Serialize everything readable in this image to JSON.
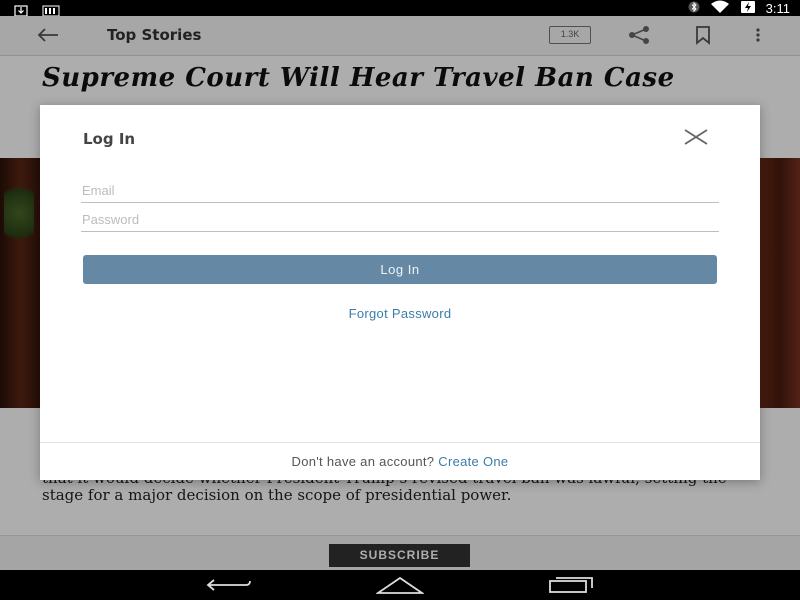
{
  "status_bar": {
    "time": "3:11",
    "icons": [
      "download-icon",
      "signal-bars-icon",
      "bluetooth-icon",
      "wifi-icon",
      "battery-charging-icon"
    ]
  },
  "app_bar": {
    "title": "Top Stories",
    "comment_count": "1.3K",
    "icons": [
      "back-arrow-icon",
      "share-icon",
      "bookmark-icon",
      "overflow-menu-icon"
    ]
  },
  "article": {
    "headline": "Supreme Court Will Hear Travel Ban Case",
    "body_visible": "that it would decide whether President Trump’s revised travel ban was lawful, setting the stage for a major decision on the scope of presidential power."
  },
  "subscribe": {
    "label": "SUBSCRIBE"
  },
  "dialog": {
    "title": "Log In",
    "email_placeholder": "Email",
    "email_value": "",
    "password_placeholder": "Password",
    "password_value": "",
    "login_label": "Log In",
    "forgot_label": "Forgot Password",
    "footer_prompt": "Don't have an account?",
    "create_label": "Create One"
  },
  "colors": {
    "login_button": "#6589a4",
    "link": "#3a7fa8",
    "overlay": "rgba(0,0,0,0.32)"
  },
  "nav_bar": {
    "icons": [
      "nav-back-icon",
      "nav-home-icon",
      "nav-recent-apps-icon"
    ]
  }
}
